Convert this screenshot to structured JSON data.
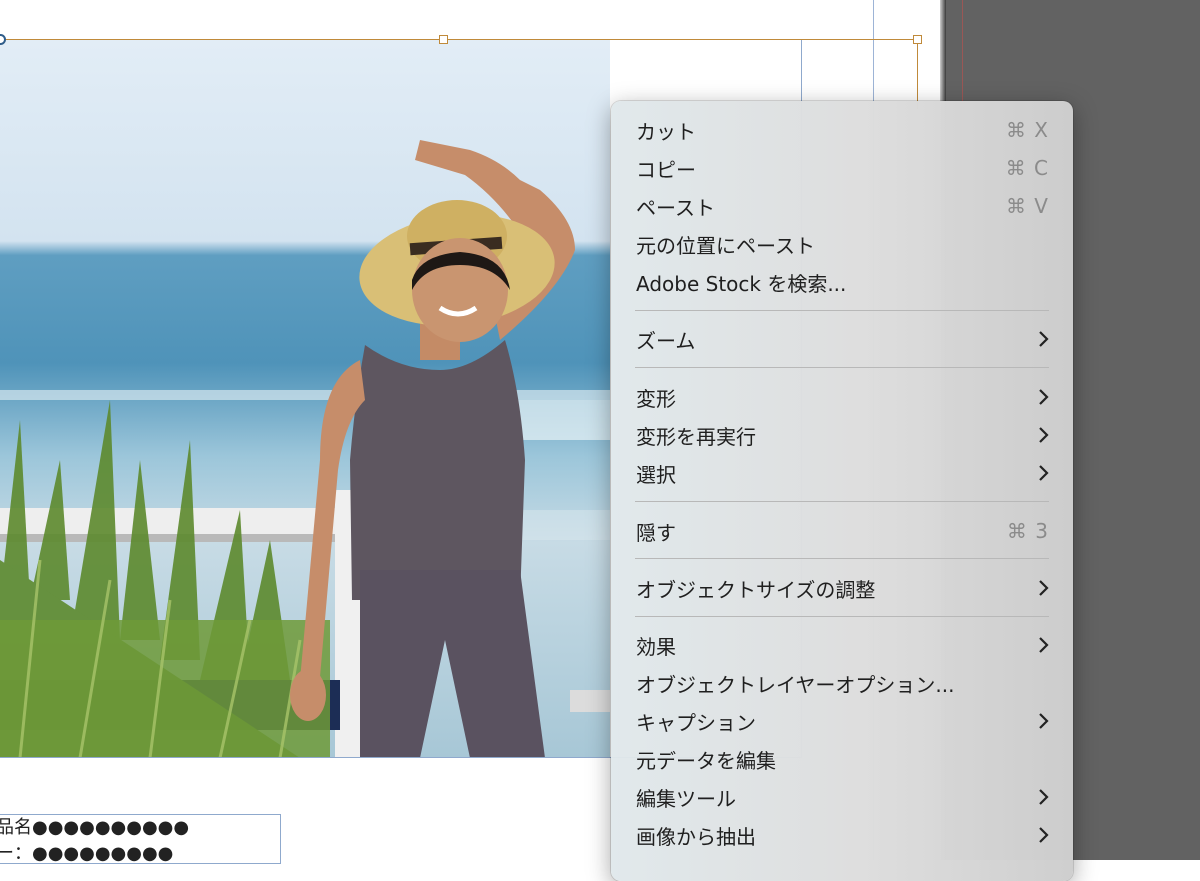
{
  "colors": {
    "selection": "#c08a3a",
    "guide": "#9db4d6",
    "pasteboard": "#626262",
    "menu_text": "#1f1f1f",
    "shortcut_text": "#8b8b8b"
  },
  "caption": {
    "line1": "品名●●●●●●●●●●",
    "line2": "ー：●●●●●●●●●"
  },
  "context_menu": {
    "items": [
      {
        "label": "カット",
        "shortcut": "⌘ X"
      },
      {
        "label": "コピー",
        "shortcut": "⌘ C"
      },
      {
        "label": "ペースト",
        "shortcut": "⌘ V"
      },
      {
        "label": "元の位置にペースト"
      },
      {
        "label": "Adobe Stock を検索..."
      },
      {
        "label": "ズーム",
        "submenu": true
      },
      {
        "label": "変形",
        "submenu": true
      },
      {
        "label": "変形を再実行",
        "submenu": true
      },
      {
        "label": "選択",
        "submenu": true
      },
      {
        "label": "隠す",
        "shortcut": "⌘ 3"
      },
      {
        "label": "オブジェクトサイズの調整",
        "submenu": true
      },
      {
        "label": "効果",
        "submenu": true
      },
      {
        "label": "オブジェクトレイヤーオプション..."
      },
      {
        "label": "キャプション",
        "submenu": true
      },
      {
        "label": "元データを編集"
      },
      {
        "label": "編集ツール",
        "submenu": true
      },
      {
        "label": "画像から抽出",
        "submenu": true
      }
    ]
  }
}
